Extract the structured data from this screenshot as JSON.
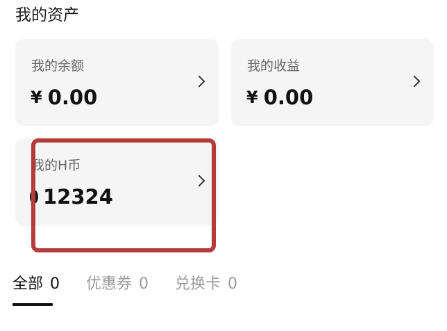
{
  "section_title": "我的资产",
  "cards": [
    {
      "label": "我的余额",
      "currency": "¥",
      "value": "0.00"
    },
    {
      "label": "我的收益",
      "currency": "¥",
      "value": "0.00"
    },
    {
      "label": "我的H币",
      "value": "12324"
    }
  ],
  "tabs": [
    {
      "label": "全部",
      "count": "0",
      "active": true
    },
    {
      "label": "优惠券",
      "count": "0",
      "active": false
    },
    {
      "label": "兑换卡",
      "count": "0",
      "active": false
    }
  ],
  "colors": {
    "highlight": "#b43b3b",
    "card_bg": "#f5f5f6"
  },
  "icons": [
    "chevron-right-icon",
    "h-coin-icon"
  ]
}
